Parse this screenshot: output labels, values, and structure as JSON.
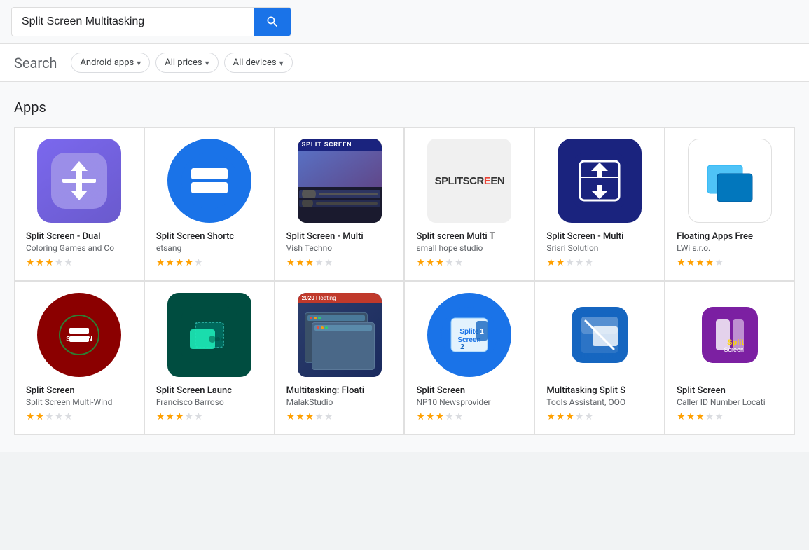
{
  "search": {
    "query": "Split Screen Multitasking",
    "placeholder": "Split Screen Multitasking",
    "button_icon": "🔍"
  },
  "filters": {
    "label": "Search",
    "items": [
      {
        "id": "android-apps",
        "label": "Android apps",
        "has_chevron": true
      },
      {
        "id": "all-prices",
        "label": "All prices",
        "has_chevron": true
      },
      {
        "id": "all-devices",
        "label": "All devices",
        "has_chevron": true
      }
    ]
  },
  "section": {
    "title": "Apps"
  },
  "apps": [
    {
      "id": "split-dual",
      "name": "Split Screen - Dual",
      "developer": "Coloring Games and Co",
      "stars": 3,
      "icon_type": "split-dual"
    },
    {
      "id": "split-shortcut",
      "name": "Split Screen Shortc",
      "developer": "etsang",
      "stars": 4,
      "icon_type": "split-shortcut"
    },
    {
      "id": "split-multi-vish",
      "name": "Split Screen - Multi",
      "developer": "Vish Techno",
      "stars": 3,
      "icon_type": "split-multi-vish"
    },
    {
      "id": "splitscreen-text",
      "name": "Split screen Multi T",
      "developer": "small hope studio",
      "stars": 3,
      "icon_type": "splitscreen-text"
    },
    {
      "id": "split-srisri",
      "name": "Split Screen - Multi",
      "developer": "Srisri Solution",
      "stars": 2,
      "icon_type": "split-srisri"
    },
    {
      "id": "floating-lw",
      "name": "Floating Apps Free",
      "developer": "LWi s.r.o.",
      "stars": 4,
      "icon_type": "floating-lw"
    },
    {
      "id": "split-dark",
      "name": "Split Screen",
      "developer": "Split Screen Multi-Wind",
      "stars": 2,
      "icon_type": "split-dark"
    },
    {
      "id": "split-francisco",
      "name": "Split Screen Launc",
      "developer": "Francisco Barroso",
      "stars": 3,
      "icon_type": "split-francisco"
    },
    {
      "id": "floating-malak",
      "name": "Multitasking: Floati",
      "developer": "MalakStudio",
      "stars": 3,
      "icon_type": "floating-malak"
    },
    {
      "id": "split-np10",
      "name": "Split Screen",
      "developer": "NP10 Newsprovider",
      "stars": 3,
      "icon_type": "split-np10"
    },
    {
      "id": "multitask-tools",
      "name": "Multitasking Split S",
      "developer": "Tools Assistant, OOO",
      "stars": 3,
      "icon_type": "multitask-tools"
    },
    {
      "id": "split-callerid",
      "name": "Split Screen",
      "developer": "Caller ID Number Locati",
      "stars": 3,
      "icon_type": "split-callerid"
    }
  ],
  "colors": {
    "blue": "#1a73e8",
    "accent": "#1a73e8"
  }
}
